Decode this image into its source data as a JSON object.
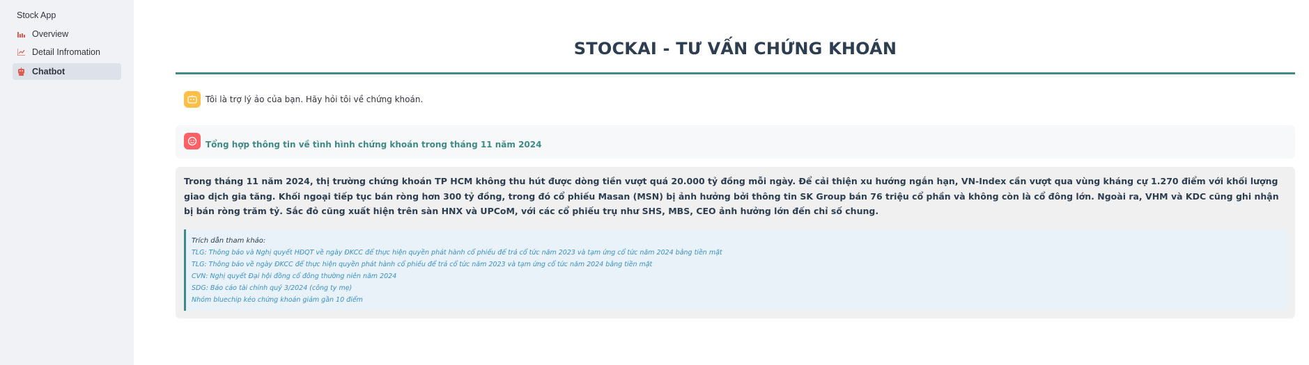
{
  "sidebar": {
    "app_name": "Stock App",
    "items": [
      {
        "label": "Overview",
        "icon": "bar-chart-icon",
        "active": false
      },
      {
        "label": "Detail Infromation",
        "icon": "line-chart-icon",
        "active": false
      },
      {
        "label": "Chatbot",
        "icon": "robot-icon",
        "active": true
      }
    ]
  },
  "main": {
    "title": "STOCKAI - TƯ VẤN CHỨNG KHOÁN",
    "bot_greeting": "Tôi là trợ lý ảo của bạn. Hãy hỏi tôi về chứng khoán.",
    "user_question": "Tổng hợp thông tin về tình hình chứng khoán trong tháng 11 năm 2024",
    "answer": "Trong tháng 11 năm 2024, thị trường chứng khoán TP HCM không thu hút được dòng tiền vượt quá 20.000 tỷ đồng mỗi ngày. Để cải thiện xu hướng ngắn hạn, VN-Index cần vượt qua vùng kháng cự 1.270 điểm với khối lượng giao dịch gia tăng. Khối ngoại tiếp tục bán ròng hơn 300 tỷ đồng, trong đó cổ phiếu Masan (MSN) bị ảnh hưởng bởi thông tin SK Group bán 76 triệu cổ phần và không còn là cổ đông lớn. Ngoài ra, VHM và KDC cũng ghi nhận bị bán ròng trăm tỷ. Sắc đỏ cũng xuất hiện trên sàn HNX và UPCoM, với các cổ phiếu trụ như SHS, MBS, CEO ảnh hưởng lớn đến chỉ số chung.",
    "references": {
      "title": "Trích dẫn tham khảo:",
      "items": [
        "TLG: Thông báo và Nghị quyết HĐQT về ngày ĐKCC để thực hiện quyền phát hành cổ phiếu để trả cổ tức năm 2023 và tạm ứng cổ tức năm 2024 bằng tiền mặt",
        "TLG: Thông báo về ngày ĐKCC để thực hiện quyền phát hành cổ phiếu để trả cổ tức năm 2023 và tạm ứng cổ tức năm 2024 bằng tiền mặt",
        "CVN: Nghị quyết Đại hội đồng cổ đông thường niên năm 2024",
        "SDG: Báo cáo tài chính quý 3/2024 (công ty mẹ)",
        "Nhóm bluechip kéo chứng khoán giảm gần 10 điểm"
      ]
    }
  },
  "colors": {
    "accent": "#3f8a86",
    "sidebar_bg": "#f0f2f6",
    "bot_avatar": "#fdbf47",
    "user_avatar": "#ff5f65",
    "link": "#3a8fc9"
  }
}
